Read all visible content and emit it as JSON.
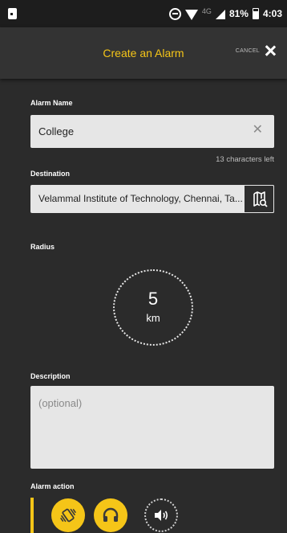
{
  "status_bar": {
    "network": "4G",
    "battery": "81%",
    "time": "4:03"
  },
  "header": {
    "title": "Create an Alarm",
    "cancel_label": "CANCEL"
  },
  "alarm_name": {
    "label": "Alarm Name",
    "value": "College",
    "chars_left": "13 characters left"
  },
  "destination": {
    "label": "Destination",
    "value": "Velammal Institute of Technology, Chennai, Ta..."
  },
  "radius": {
    "label": "Radius",
    "value": "5",
    "unit": "km"
  },
  "description": {
    "label": "Description",
    "placeholder": "(optional)"
  },
  "alarm_action": {
    "label": "Alarm action",
    "options": [
      {
        "icon": "vibrate-icon",
        "selected": true
      },
      {
        "icon": "headphones-icon",
        "selected": true
      },
      {
        "icon": "speaker-icon",
        "selected": false
      }
    ]
  },
  "colors": {
    "accent": "#f5c518",
    "background": "#2b2b2b",
    "header": "#333333",
    "field": "#e6e6e6"
  }
}
